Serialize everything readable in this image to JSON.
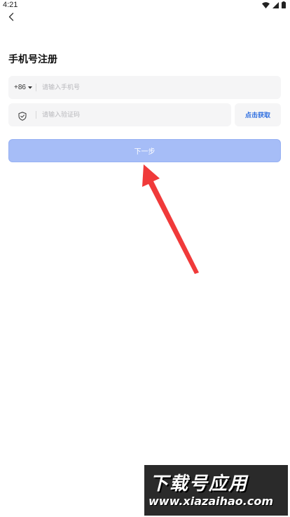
{
  "status_bar": {
    "time": "4:21",
    "icons": [
      "wifi-icon",
      "cell-signal-icon",
      "battery-icon"
    ]
  },
  "nav": {
    "back_icon": "chevron-left-icon"
  },
  "page": {
    "title": "手机号注册"
  },
  "phone_field": {
    "country_code": "+86",
    "dropdown_icon": "caret-down-icon",
    "placeholder": "请输入手机号",
    "value": ""
  },
  "code_field": {
    "icon": "shield-icon",
    "placeholder": "请输入验证码",
    "value": ""
  },
  "get_code_button": {
    "label": "点击获取"
  },
  "next_button": {
    "label": "下一步",
    "state": "disabled"
  },
  "watermark": {
    "title": "下载号应用",
    "url": "www.xiazaihao.com"
  },
  "colors": {
    "primary_disabled": "#a6bdf7",
    "link_blue": "#2f6fe0",
    "field_bg": "#f5f5f6",
    "arrow_red": "#f03a3a"
  }
}
